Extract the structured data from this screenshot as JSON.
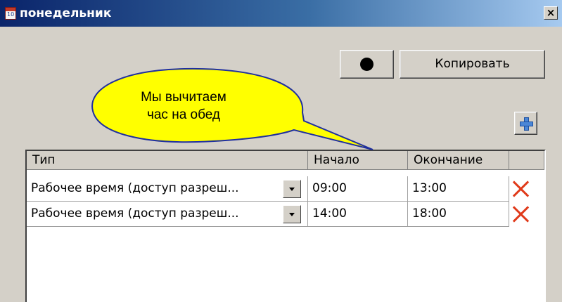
{
  "window": {
    "title": "понедельник",
    "close_label": "×"
  },
  "toolbar": {
    "copy_label": "Копировать"
  },
  "callout": {
    "line1": "Мы вычитаем",
    "line2": "час на обед"
  },
  "table": {
    "columns": [
      "Тип",
      "Начало",
      "Окончание"
    ],
    "rows": [
      {
        "type": "Рабочее время (доступ разреш...",
        "start": "09:00",
        "end": "13:00"
      },
      {
        "type": "Рабочее время (доступ разреш...",
        "start": "14:00",
        "end": "18:00"
      }
    ]
  },
  "icons": {
    "app": "calendar-icon",
    "record": "record-dot-icon",
    "add": "plus-icon",
    "delete": "delete-x-icon",
    "dropdown": "chevron-down-icon"
  },
  "colors": {
    "titlebar_start": "#0a246a",
    "titlebar_end": "#a6caf0",
    "window_bg": "#d4d0c8",
    "callout_fill": "#ffff00",
    "delete_red": "#e03a1a",
    "add_blue": "#4a86d6"
  }
}
